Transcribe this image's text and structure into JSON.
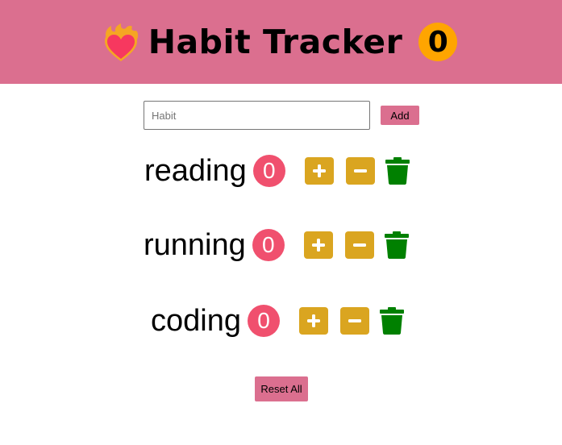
{
  "header": {
    "title": "Habit Tracker",
    "total_count": "0",
    "logo_icon": "heart-on-fire-icon"
  },
  "form": {
    "input_value": "",
    "input_placeholder": "Habit",
    "add_label": "Add"
  },
  "habits": [
    {
      "name": "reading",
      "count": "0"
    },
    {
      "name": "running",
      "count": "0"
    },
    {
      "name": "coding",
      "count": "0"
    }
  ],
  "reset_label": "Reset All",
  "colors": {
    "accent": "#db6f8f",
    "total_badge": "#ffa500",
    "count_badge": "#f0506e",
    "action_button": "#daa520",
    "trash": "#008000"
  }
}
